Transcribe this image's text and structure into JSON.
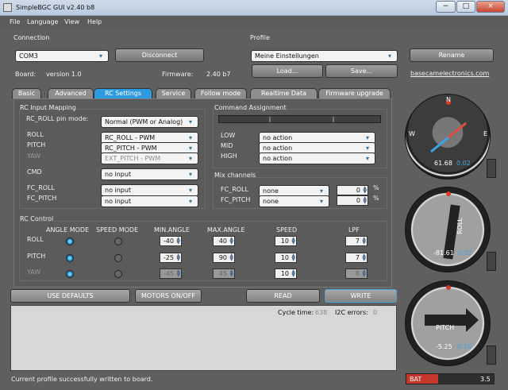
{
  "window": {
    "title": "SimpleBGC GUI v2.40 b8",
    "min": "−",
    "max": "□",
    "close": "×"
  },
  "menu": [
    "File",
    "Language",
    "View",
    "Help"
  ],
  "connection": {
    "label": "Connection",
    "port": "COM3",
    "disconnect": "Disconnect",
    "board_label": "Board:",
    "board_value": "version 1.0",
    "firmware_label": "Firmware:",
    "firmware_value": "2.40 b7"
  },
  "profile": {
    "label": "Profile",
    "name": "Meine Einstellungen",
    "rename": "Rename",
    "load": "Load...",
    "save": "Save...",
    "link": "basecamelectronics.com"
  },
  "tabs": [
    "Basic",
    "Advanced",
    "RC Settings",
    "Service",
    "Follow mode",
    "Realtime Data",
    "Firmware upgrade"
  ],
  "rc_input": {
    "title": "RC Input Mapping",
    "roll_pin_label": "RC_ROLL pin mode:",
    "roll_pin_value": "Normal (PWM or Analog)",
    "roll": "ROLL",
    "pitch": "PITCH",
    "yaw": "YAW",
    "roll_value": "RC_ROLL - PWM",
    "pitch_value": "RC_PITCH - PWM",
    "yaw_value": "EXT_PITCH - PWM",
    "cmd": "CMD",
    "cmd_value": "no input",
    "fc_roll": "FC_ROLL",
    "fc_roll_value": "no input",
    "fc_pitch": "FC_PITCH",
    "fc_pitch_value": "no input"
  },
  "command": {
    "title": "Command Assignment",
    "low": "LOW",
    "mid": "MID",
    "high": "HIGH",
    "low_value": "no action",
    "mid_value": "no action",
    "high_value": "no action"
  },
  "mix": {
    "title": "Mix channels",
    "fc_roll": "FC_ROLL",
    "fc_pitch": "FC_PITCH",
    "roll_value": "none",
    "pitch_value": "none",
    "roll_pct": "0",
    "pitch_pct": "0",
    "percent": "%"
  },
  "rc_control": {
    "title": "RC Control",
    "headers": [
      "ANGLE MODE",
      "SPEED MODE",
      "MIN.ANGLE",
      "MAX.ANGLE",
      "SPEED",
      "LPF"
    ],
    "rows": [
      {
        "name": "ROLL",
        "min": "-40",
        "max": "40",
        "speed": "10",
        "lpf": "7"
      },
      {
        "name": "PITCH",
        "min": "-25",
        "max": "90",
        "speed": "10",
        "lpf": "7"
      },
      {
        "name": "YAW",
        "min": "-45",
        "max": "45",
        "speed": "10",
        "lpf": "8"
      }
    ]
  },
  "actions": {
    "defaults": "USE DEFAULTS",
    "motors": "MOTORS ON/OFF",
    "read": "READ",
    "write": "WRITE"
  },
  "stats": {
    "cycle_label": "Cycle time:",
    "cycle_value": "638",
    "i2c_label": "I2C errors:",
    "i2c_value": "0"
  },
  "gauges": [
    {
      "label": "",
      "n": "N",
      "w": "W",
      "e": "E",
      "angle": "61.68",
      "rate": "0.02"
    },
    {
      "label": "ROLL",
      "angle": "-81.61",
      "rate": "0.02"
    },
    {
      "label": "PITCH",
      "angle": "-5.25",
      "rate": "0.16"
    }
  ],
  "battery": {
    "label": "BAT",
    "value": "3.5"
  },
  "status": "Current profile successfully written to board."
}
